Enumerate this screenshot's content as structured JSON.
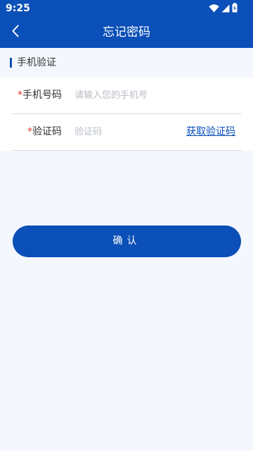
{
  "status_bar": {
    "time": "9:25",
    "icons": [
      "wifi-icon",
      "cellular-signal-icon",
      "battery-charging-icon"
    ]
  },
  "app_bar": {
    "back_icon": "chevron-left-icon",
    "title": "忘记密码"
  },
  "section": {
    "title": "手机验证"
  },
  "form": {
    "phone": {
      "required_mark": "*",
      "label": "手机号码",
      "value": "",
      "placeholder": "请输入您的手机号"
    },
    "code": {
      "required_mark": "*",
      "label": "验证码",
      "value": "",
      "placeholder": "验证码",
      "get_code_label": "获取验证码"
    }
  },
  "confirm_button": {
    "label": "确认"
  },
  "colors": {
    "primary": "#0b4fb8",
    "background": "#f4f7fd",
    "required": "#e5352c",
    "placeholder": "#b7bcc4"
  }
}
